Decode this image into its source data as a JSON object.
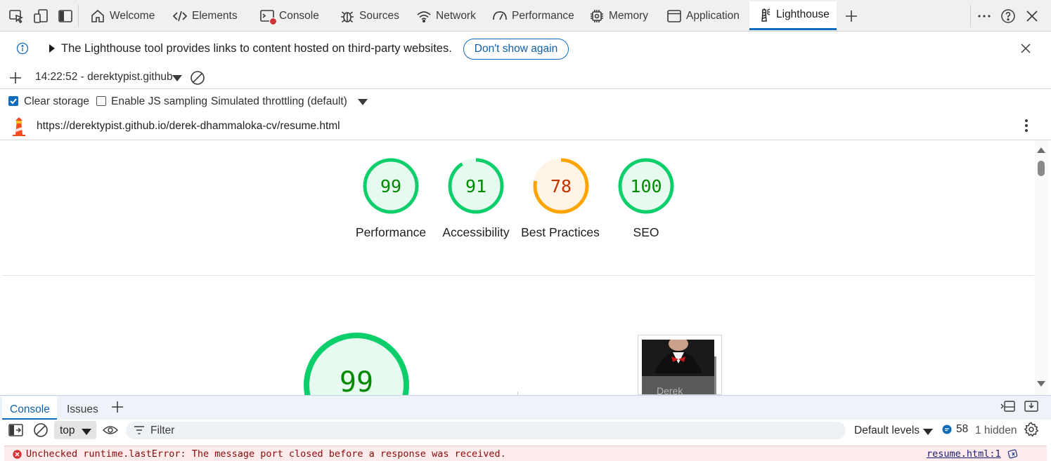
{
  "tabs": {
    "welcome": "Welcome",
    "elements": "Elements",
    "console": "Console",
    "sources": "Sources",
    "network": "Network",
    "performance": "Performance",
    "memory": "Memory",
    "application": "Application",
    "lighthouse": "Lighthouse"
  },
  "infobar": {
    "message": "The Lighthouse tool provides links to content hosted on third-party websites.",
    "dont_show": "Don't show again"
  },
  "report_selector": "14:22:52 - derektypist.github",
  "options": {
    "clear_storage": "Clear storage",
    "js_sampling": "Enable JS sampling",
    "throttling": "Simulated throttling (default)"
  },
  "url": "https://derektypist.github.io/derek-dhammaloka-cv/resume.html",
  "scores": [
    {
      "label": "Performance",
      "value": "99"
    },
    {
      "label": "Accessibility",
      "value": "91"
    },
    {
      "label": "Best Practices",
      "value": "78"
    },
    {
      "label": "SEO",
      "value": "100"
    }
  ],
  "big_score": "99",
  "preview_text": "Derek",
  "drawer": {
    "console_tab": "Console",
    "issues_tab": "Issues",
    "context": "top",
    "filter_placeholder": "Filter",
    "levels": "Default levels",
    "msg_count": "58",
    "hidden": "1 hidden"
  },
  "error": {
    "message": "Unchecked runtime.lastError: The message port closed before a response was received.",
    "source": "resume.html:1"
  },
  "colors": {
    "pass": "#0cce6b",
    "pass_text": "#008800",
    "average": "#ffa400",
    "average_text": "#c33300",
    "accent": "#0f6cbd"
  }
}
